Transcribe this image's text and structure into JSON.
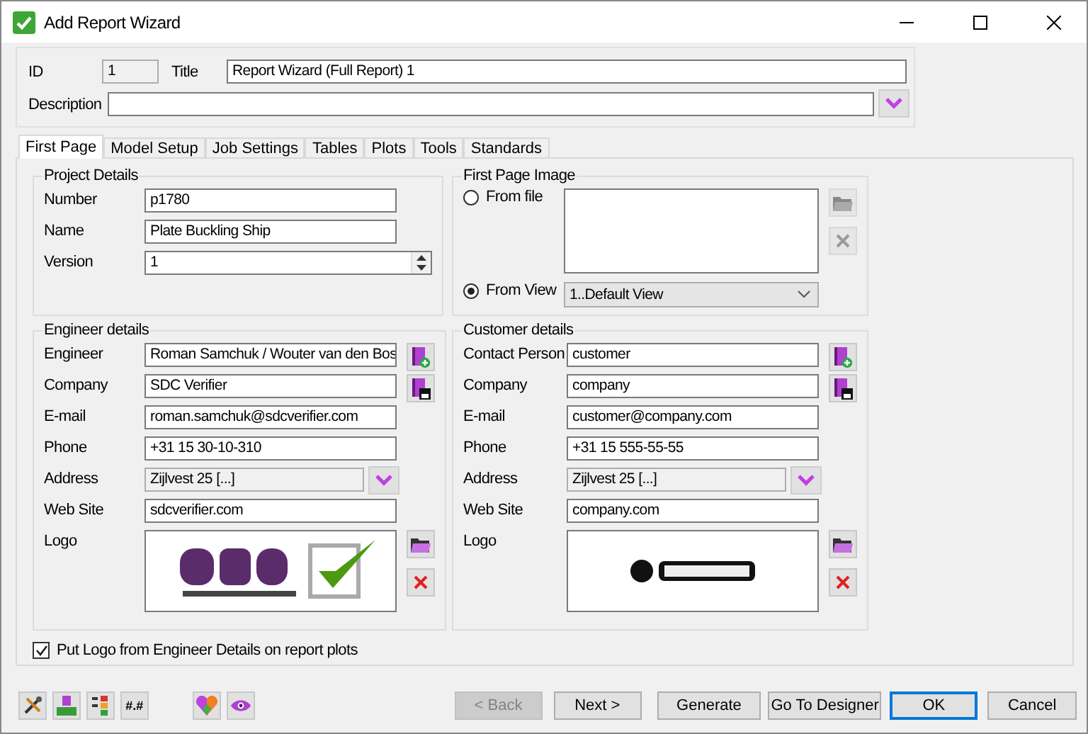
{
  "window": {
    "title": "Add Report Wizard"
  },
  "header": {
    "id_label": "ID",
    "id_value": "1",
    "title_label": "Title",
    "title_value": "Report Wizard (Full Report) 1",
    "description_label": "Description"
  },
  "tabs": [
    {
      "label": "First Page",
      "selected": true
    },
    {
      "label": "Model Setup",
      "selected": false
    },
    {
      "label": "Job Settings",
      "selected": false
    },
    {
      "label": "Tables",
      "selected": false
    },
    {
      "label": "Plots",
      "selected": false
    },
    {
      "label": "Tools",
      "selected": false
    },
    {
      "label": "Standards",
      "selected": false
    }
  ],
  "project_details": {
    "title": "Project Details",
    "fields": [
      {
        "label": "Number",
        "value": "p1780",
        "kind": "text"
      },
      {
        "label": "Name",
        "value": "Plate Buckling Ship",
        "kind": "text"
      },
      {
        "label": "Version",
        "value": "1",
        "kind": "spin"
      }
    ]
  },
  "first_page_image": {
    "title": "First Page Image",
    "options": [
      {
        "label": "From file",
        "selected": false,
        "kind": "file"
      },
      {
        "label": "From View",
        "selected": true,
        "kind": "view",
        "value": "1..Default View"
      }
    ]
  },
  "engineer_details": {
    "title": "Engineer details",
    "fields": [
      {
        "label": "Engineer",
        "value": "Roman Samchuk / Wouter van den Bos",
        "kind": "text"
      },
      {
        "label": "Company",
        "value": "SDC Verifier",
        "kind": "text"
      },
      {
        "label": "E-mail",
        "value": "roman.samchuk@sdcverifier.com",
        "kind": "text"
      },
      {
        "label": "Phone",
        "value": "+31 15 30-10-310",
        "kind": "text"
      },
      {
        "label": "Address",
        "value": "Zijlvest 25 [...]",
        "kind": "address"
      },
      {
        "label": "Web Site",
        "value": "sdcverifier.com",
        "kind": "text"
      },
      {
        "label": "Logo",
        "kind": "logo"
      }
    ]
  },
  "customer_details": {
    "title": "Customer details",
    "fields": [
      {
        "label": "Contact Person",
        "value": "customer",
        "kind": "text"
      },
      {
        "label": "Company",
        "value": "company",
        "kind": "text"
      },
      {
        "label": "E-mail",
        "value": "customer@company.com",
        "kind": "text"
      },
      {
        "label": "Phone",
        "value": "+31 15 555-55-55",
        "kind": "text"
      },
      {
        "label": "Address",
        "value": "Zijlvest 25 [...]",
        "kind": "address"
      },
      {
        "label": "Web Site",
        "value": "company.com",
        "kind": "text"
      },
      {
        "label": "Logo",
        "kind": "logo"
      }
    ]
  },
  "put_logo": {
    "label": "Put Logo from Engineer Details on report plots",
    "checked": true
  },
  "tool_buttons": [
    {
      "kind": "tools"
    },
    {
      "kind": "units"
    },
    {
      "kind": "numbering"
    },
    {
      "kind": "format",
      "label": "#.#"
    },
    {
      "kind": "colors"
    },
    {
      "kind": "view"
    }
  ],
  "buttons": [
    {
      "label": "< Back",
      "disabled": true,
      "default": false
    },
    {
      "label": "Next >",
      "disabled": false,
      "default": false
    },
    {
      "label": "Generate",
      "disabled": false,
      "default": false
    },
    {
      "label": "Go To Designer",
      "disabled": false,
      "default": false
    },
    {
      "label": "OK",
      "disabled": false,
      "default": true
    },
    {
      "label": "Cancel",
      "disabled": false,
      "default": false
    }
  ]
}
